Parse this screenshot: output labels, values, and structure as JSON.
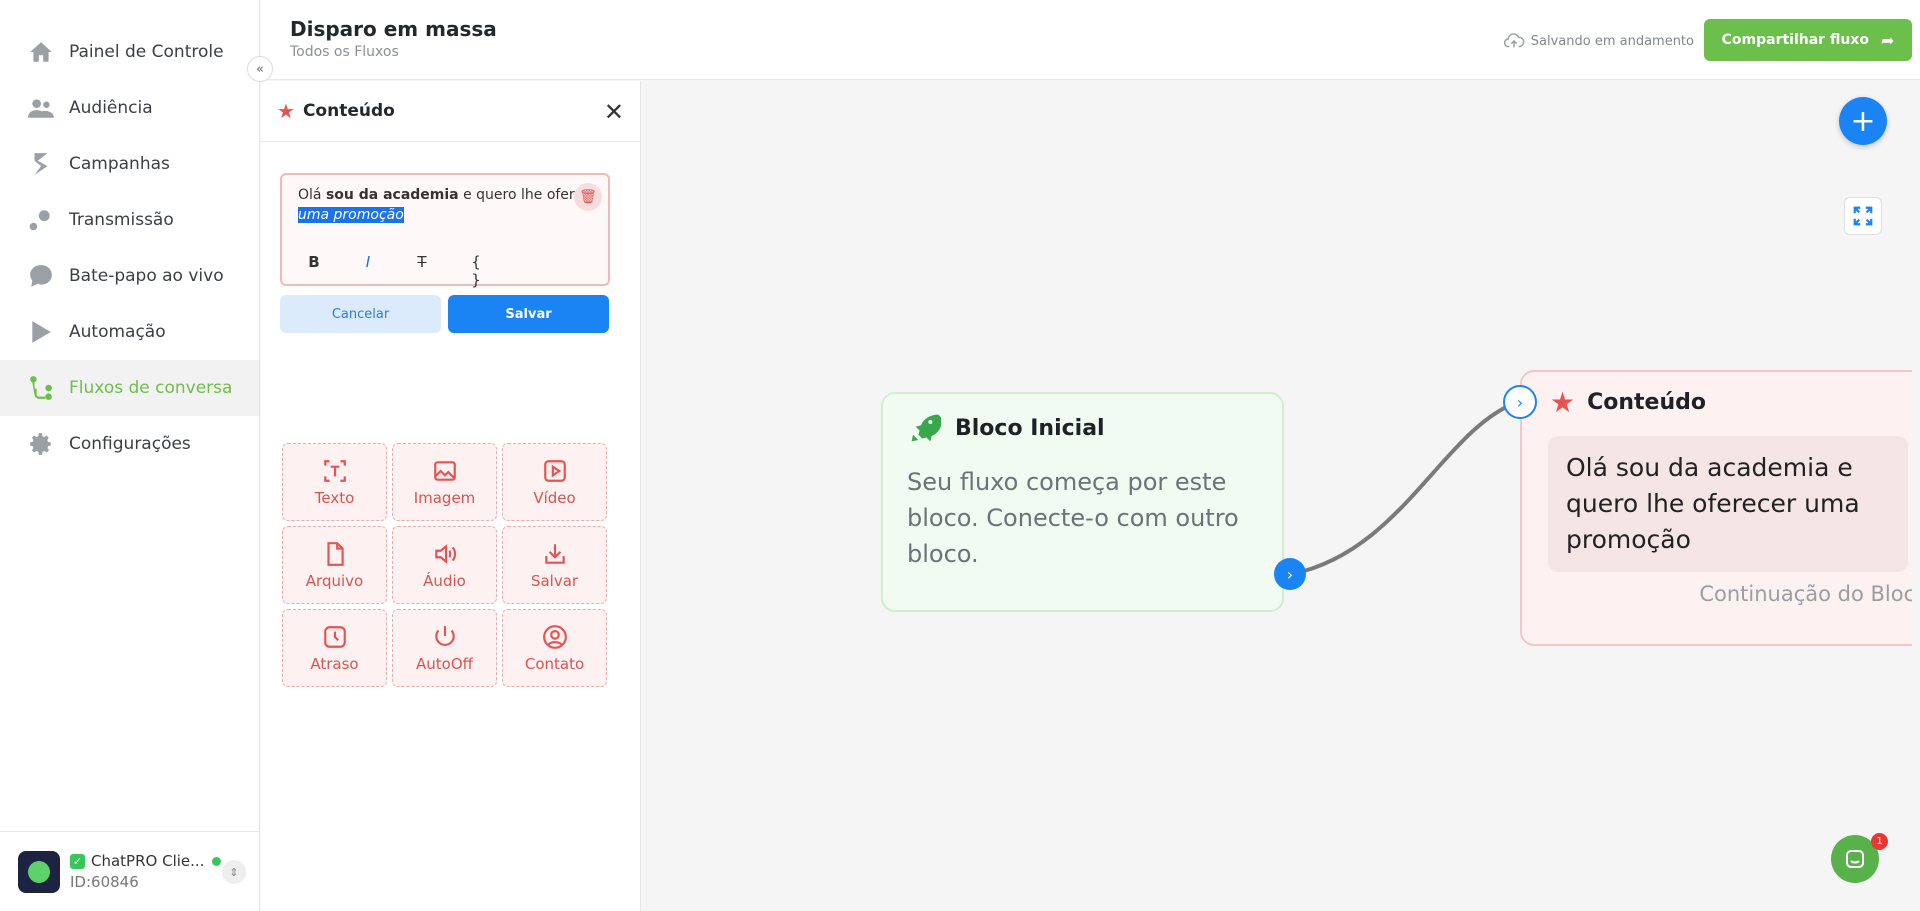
{
  "sidebar": {
    "items": [
      {
        "label": "Painel de Controle",
        "icon": "home-icon"
      },
      {
        "label": "Audiência",
        "icon": "users-icon"
      },
      {
        "label": "Campanhas",
        "icon": "campaign-icon"
      },
      {
        "label": "Transmissão",
        "icon": "broadcast-icon"
      },
      {
        "label": "Bate-papo ao vivo",
        "icon": "chat-icon"
      },
      {
        "label": "Automação",
        "icon": "automation-icon"
      },
      {
        "label": "Fluxos de conversa",
        "icon": "flow-icon",
        "active": true
      },
      {
        "label": "Configurações",
        "icon": "gear-icon"
      }
    ],
    "account": {
      "name": "ChatPRO Clie...",
      "id": "ID:60846"
    }
  },
  "header": {
    "title": "Disparo em massa",
    "subtitle": "Todos os Fluxos",
    "save_status": "Salvando em andamento",
    "share_label": "Compartilhar fluxo"
  },
  "panel": {
    "title": "Conteúdo",
    "editor": {
      "part1": "Olá ",
      "bold": "sou da academia",
      "part2": " e quero lhe oferecer",
      "selected": "uma promoção"
    },
    "toolbar": {
      "bold": "B",
      "italic": "I",
      "strike": "T",
      "variable": "{ }"
    },
    "cancel_label": "Cancelar",
    "save_label": "Salvar",
    "blocks": [
      {
        "label": "Texto",
        "icon": "text-icon"
      },
      {
        "label": "Imagem",
        "icon": "image-icon"
      },
      {
        "label": "Vídeo",
        "icon": "video-icon"
      },
      {
        "label": "Arquivo",
        "icon": "file-icon"
      },
      {
        "label": "Áudio",
        "icon": "audio-icon"
      },
      {
        "label": "Salvar",
        "icon": "download-icon"
      },
      {
        "label": "Atraso",
        "icon": "clock-icon"
      },
      {
        "label": "AutoOff",
        "icon": "power-icon"
      },
      {
        "label": "Contato",
        "icon": "contact-icon"
      }
    ]
  },
  "canvas": {
    "start_node": {
      "title": "Bloco Inicial",
      "body": "Seu fluxo começa por este bloco. Conecte-o com outro bloco."
    },
    "content_node": {
      "title": "Conteúdo",
      "message": "Olá sou da academia e quero lhe oferecer uma promoção",
      "continuation": "Continuação do Bloco"
    },
    "chat_badge": "1"
  },
  "colors": {
    "brand_green": "#6cbf4a",
    "primary_blue": "#1a84f5",
    "accent_red": "#e55353"
  }
}
